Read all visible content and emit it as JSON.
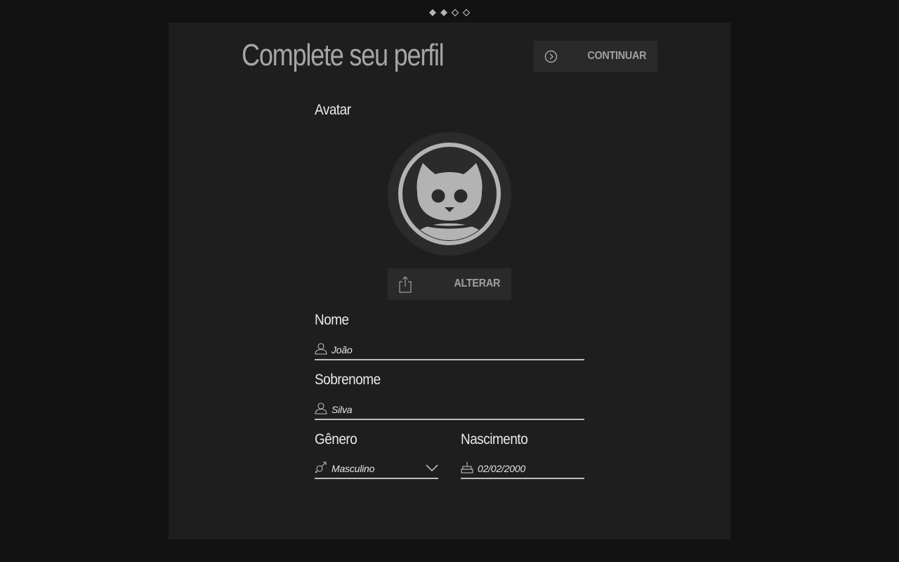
{
  "progress": {
    "steps_total": 4,
    "steps_completed": 2,
    "color": "#b5b5b5"
  },
  "header": {
    "title": "Complete seu perfil",
    "continue_label": "CONTINUAR"
  },
  "avatar": {
    "section_label": "Avatar",
    "change_label": "ALTERAR"
  },
  "form": {
    "first_name": {
      "label": "Nome",
      "value": "João",
      "icon": "user-icon"
    },
    "last_name": {
      "label": "Sobrenome",
      "value": "Silva",
      "icon": "user-icon"
    },
    "gender": {
      "label": "Gênero",
      "value": "Masculino",
      "icon": "gender-icon"
    },
    "birth": {
      "label": "Nascimento",
      "value": "02/02/2000",
      "icon": "cake-icon"
    }
  },
  "colors": {
    "background": "#121212",
    "panel": "#1e1e1e",
    "button": "#2a2a2a",
    "text": "#eaeaea",
    "muted": "#a6a6a6"
  }
}
